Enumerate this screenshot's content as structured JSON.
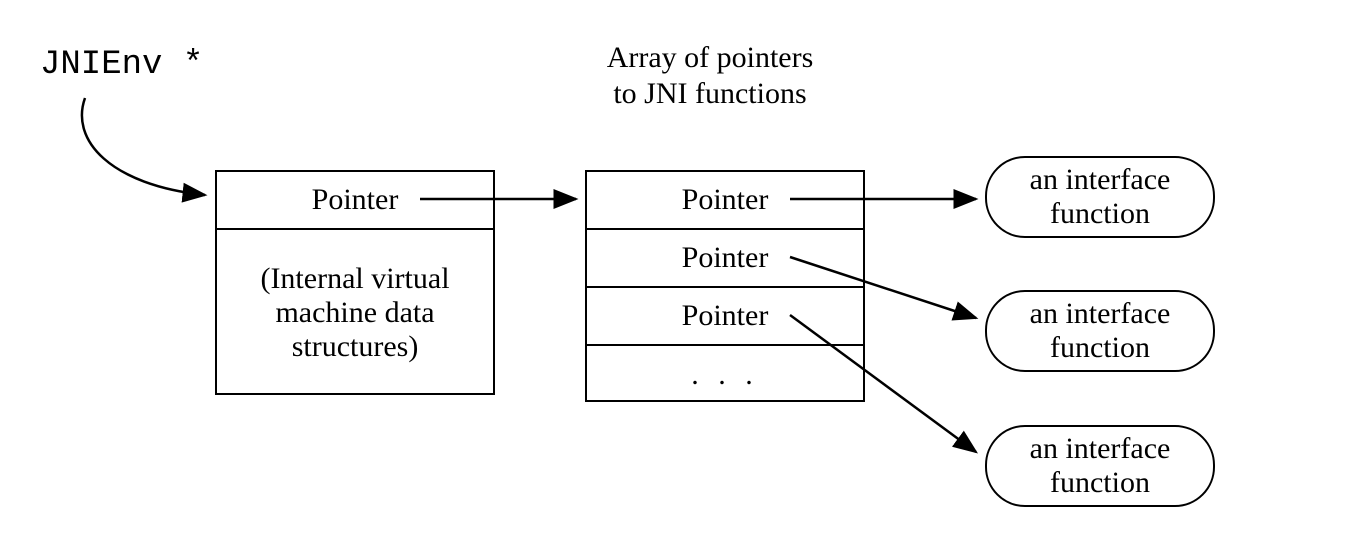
{
  "labels": {
    "jnienv": "JNIEnv *",
    "array_title_l1": "Array of pointers",
    "array_title_l2": "to  JNI functions"
  },
  "left_box": {
    "pointer": "Pointer",
    "desc_l1": "(Internal virtual",
    "desc_l2": "machine data",
    "desc_l3": "structures)"
  },
  "array_cells": {
    "c0": "Pointer",
    "c1": "Pointer",
    "c2": "Pointer",
    "c3": ".  .  ."
  },
  "capsules": {
    "f0_l1": "an interface",
    "f0_l2": "function",
    "f1_l1": "an interface",
    "f1_l2": "function",
    "f2_l1": "an interface",
    "f2_l2": "function"
  }
}
